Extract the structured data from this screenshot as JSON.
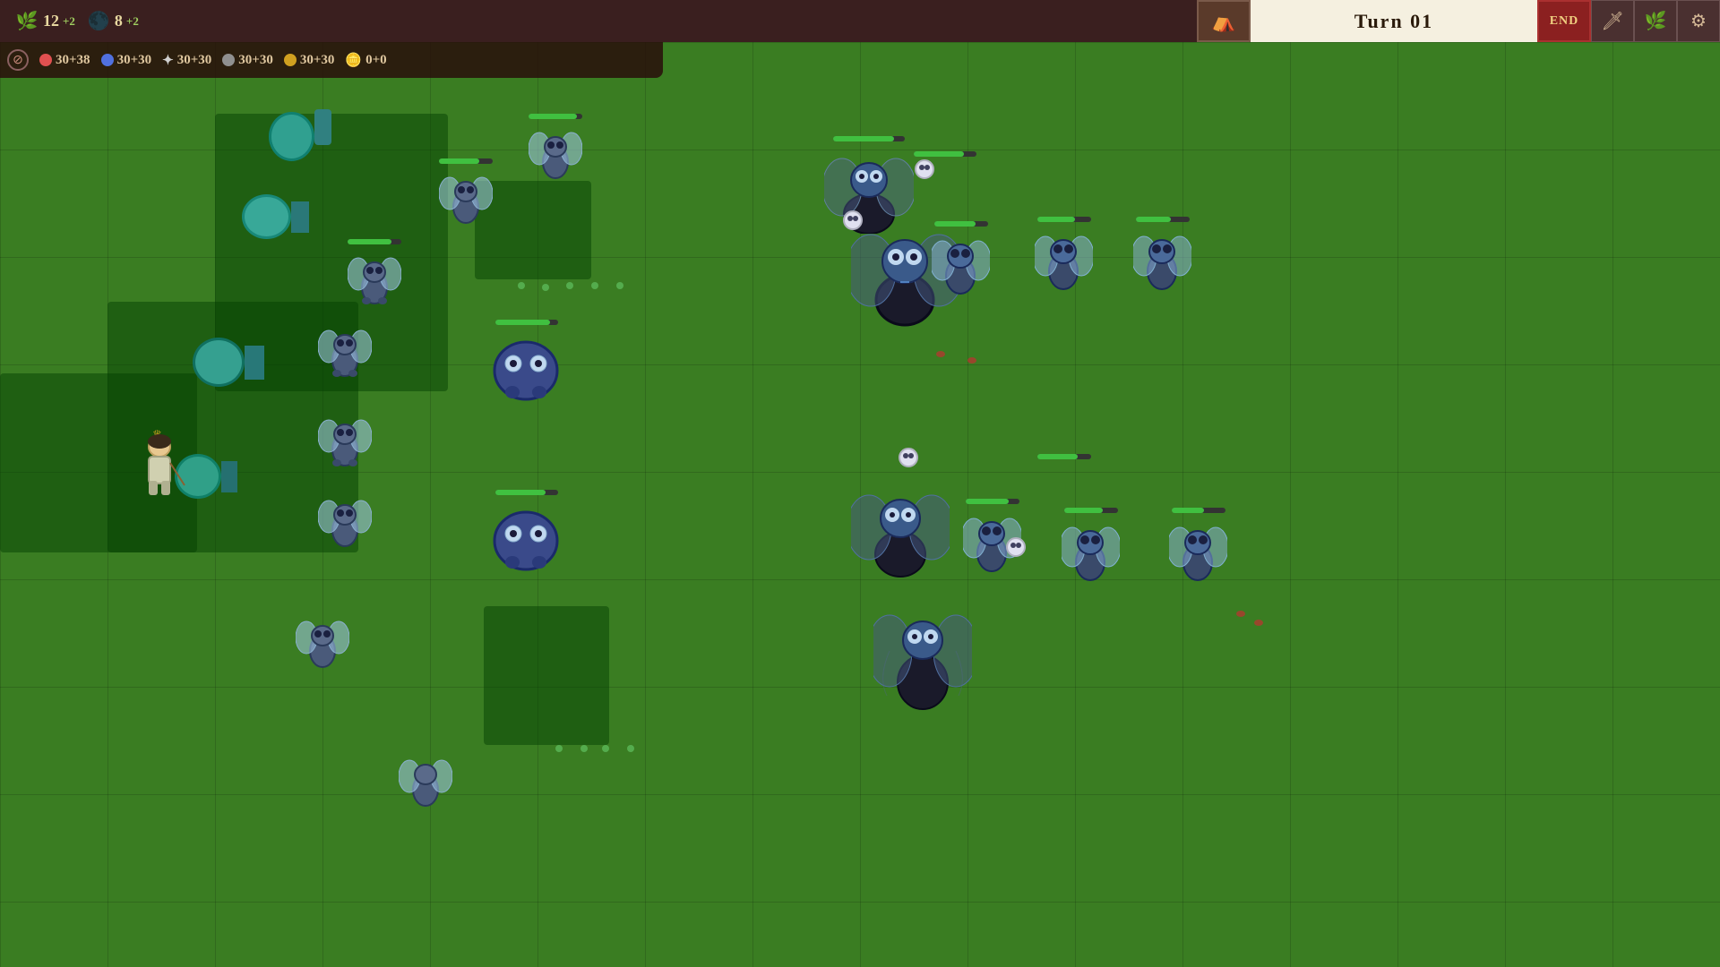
{
  "header": {
    "resources": {
      "leaf": {
        "value": "12",
        "bonus": "+2",
        "icon": "🌿"
      },
      "seed": {
        "value": "8",
        "bonus": "+2",
        "icon": "🌑"
      }
    },
    "turn_label": "Turn 01",
    "camp_icon": "⛺",
    "end_label": "END",
    "icon1": "🗡",
    "icon2": "🌿",
    "icon3": "⚙"
  },
  "status_bar": {
    "items": [
      {
        "color": "red",
        "text": "30+38"
      },
      {
        "color": "blue",
        "text": "30+30"
      },
      {
        "color": "star",
        "text": "30+30"
      },
      {
        "color": "gray",
        "text": "30+30"
      },
      {
        "color": "gold",
        "text": "30+30"
      },
      {
        "color": "coin",
        "text": "0+0"
      }
    ]
  },
  "grid": {
    "cell_size": 120,
    "cols": 16,
    "rows": 9
  }
}
